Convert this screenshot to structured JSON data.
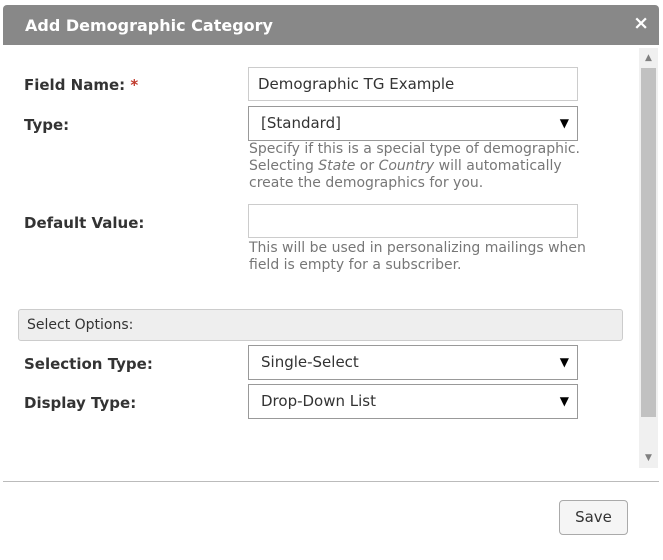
{
  "dialog": {
    "title": "Add Demographic Category",
    "close_icon": "×",
    "field_name": {
      "label": "Field Name:",
      "required_mark": "*",
      "value": "Demographic TG Example"
    },
    "type": {
      "label": "Type:",
      "selected": "[Standard]",
      "help_line1": "Specify if this is a special type of demographic.",
      "help_line2_prefix": "Selecting ",
      "help_line2_state": "State",
      "help_line2_or": " or ",
      "help_line2_country": "Country",
      "help_line2_suffix": " will automatically",
      "help_line3": "create the demographics for you."
    },
    "default_value": {
      "label": "Default Value:",
      "value": "",
      "help_line1": "This will be used in personalizing mailings when",
      "help_line2": "field is empty for a subscriber."
    },
    "select_options_heading": "Select Options:",
    "selection_type": {
      "label": "Selection Type:",
      "selected": "Single-Select"
    },
    "display_type": {
      "label": "Display Type:",
      "selected": "Drop-Down List"
    },
    "save_label": "Save",
    "caret": "▼",
    "scroll_up": "▲",
    "scroll_down": "▼"
  },
  "colors": {
    "titlebar": "#888888",
    "required": "#c0392b",
    "help_text": "#777777"
  }
}
